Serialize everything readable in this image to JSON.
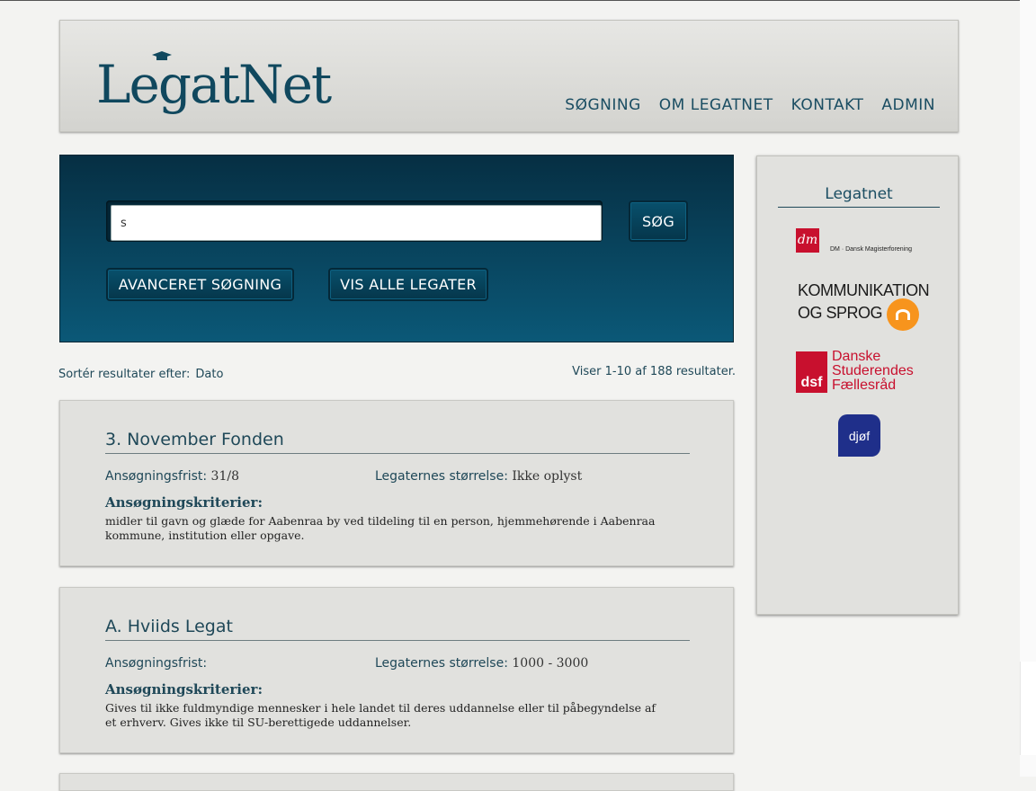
{
  "header": {
    "logo_text": "LegatNet",
    "nav": [
      "SØGNING",
      "OM LEGATNET",
      "KONTAKT",
      "ADMIN"
    ]
  },
  "search": {
    "query": "s",
    "search_button": "SØG",
    "advanced_button": "AVANCERET SØGNING",
    "all_button": "VIS ALLE LEGATER"
  },
  "sort": {
    "label": "Sortér resultater efter:",
    "value": "Dato"
  },
  "results_count": "Viser 1-10 af 188 resultater.",
  "results": [
    {
      "title": "3. November Fonden",
      "deadline_label": "Ansøgningsfrist:",
      "deadline": "31/8",
      "size_label": "Legaternes størrelse:",
      "size": "Ikke oplyst",
      "criteria_label": "Ansøgningskriterier:",
      "criteria": "midler til gavn og glæde for Aabenraa by ved tildeling til en person, hjemmehørende i Aabenraa kommune, institution eller opgave."
    },
    {
      "title": "A. Hviids Legat",
      "deadline_label": "Ansøgningsfrist:",
      "deadline": "",
      "size_label": "Legaternes størrelse:",
      "size": "1000 - 3000",
      "criteria_label": "Ansøgningskriterier:",
      "criteria": "Gives til ikke fuldmyndige mennesker i hele landet til deres uddannelse eller til påbegyndelse af et erhverv. Gives ikke til SU-berettigede uddannelser."
    }
  ],
  "sidebar": {
    "title": "Legatnet",
    "logos": {
      "dm": "DM · Dansk Magisterforening",
      "ks_line1": "KOMMUNIKATION",
      "ks_line2": "OG SPROG",
      "dsf_mark": "dsf",
      "dsf_text": "Danske Studerendes Fællesråd",
      "djof": "djøf"
    }
  },
  "colors": {
    "accent": "#0b5877",
    "text": "#1f4858",
    "card": "#e1e1de",
    "red": "#c8102e"
  }
}
